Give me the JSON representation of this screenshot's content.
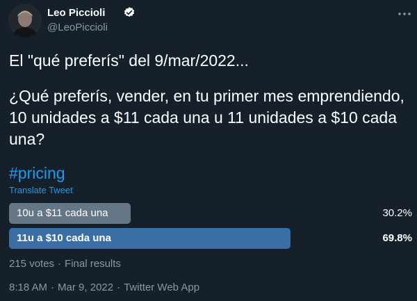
{
  "author": {
    "name": "Leo Piccioli",
    "handle": "@LeoPiccioli"
  },
  "tweet": {
    "lines": [
      "El \"qué preferís\" del 9/mar/2022...",
      "¿Qué preferís, vender, en tu primer mes emprendiendo,",
      "10 unidades a $11 cada una u 11 unidades a $10 cada",
      "una?"
    ],
    "hashtag": "#pricing",
    "translate_label": "Translate Tweet"
  },
  "poll": {
    "options": [
      {
        "label": "10u a $11 cada una",
        "percent_label": "30.2%",
        "percent": 30.2,
        "winner": false,
        "color": "#657786"
      },
      {
        "label": "11u a $10 cada una",
        "percent_label": "69.8%",
        "percent": 69.8,
        "winner": true,
        "color": "#3a6fa6"
      }
    ],
    "votes": "215 votes",
    "status": "Final results"
  },
  "footer": {
    "time": "8:18 AM",
    "date": "Mar 9, 2022",
    "source": "Twitter Web App"
  },
  "icons": {
    "verified": "verified-badge-icon",
    "more": "more-dots-icon"
  },
  "colors": {
    "background": "#15202b",
    "accent": "#1d9bf0",
    "muted": "#8899a6"
  }
}
